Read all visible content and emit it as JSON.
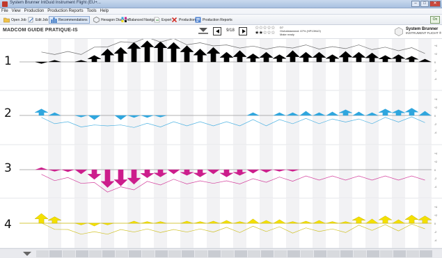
{
  "window": {
    "title": "System Brunner IntGuid Instrument Flight (EU+...",
    "buttons": [
      "–",
      "□",
      "✕"
    ]
  },
  "menu": {
    "items": [
      "File",
      "View",
      "Production",
      "Production Reports",
      "Tools",
      "Help"
    ]
  },
  "toolbar": {
    "items": [
      {
        "label": "Open Job",
        "icon": "folder-icon"
      },
      {
        "label": "Edit Job",
        "icon": "edit-icon"
      },
      {
        "label": "Recommendations",
        "icon": "bar-chart-icon",
        "active": true
      },
      {
        "label": "Hexagon Diagram",
        "icon": "hexagon-icon"
      },
      {
        "label": "Balanced Navigator",
        "icon": "navigator-icon"
      },
      {
        "label": "Export",
        "icon": "export-icon"
      },
      {
        "label": "Production",
        "icon": "close-red-icon"
      },
      {
        "label": "Production Reports",
        "icon": "report-icon"
      }
    ],
    "help_label": "On"
  },
  "header": {
    "guide_title": "MADCOM GUIDE PRATIQUE-IS",
    "page_indicator": "9/18",
    "stars_top": "☆☆☆☆☆",
    "stars_bottom_filled": "★★",
    "stars_bottom_empty": "☆☆☆",
    "meta_line1": "D7",
    "meta_line2": "Globalstandard: 67% (HP1394/2)",
    "meta_line3": "Make ready",
    "brand_name": "System Brunner",
    "brand_sub": "INSTRUMENT FLIGHT ®"
  },
  "rows": [
    {
      "label": "1",
      "color": "#000000",
      "bars": [
        -0.1,
        0.2,
        0,
        0.2,
        0.8,
        1.6,
        1.8,
        2.4,
        2.6,
        2.5,
        2.4,
        2.0,
        1.6,
        1.8,
        1.2,
        1.4,
        1.0,
        1.2,
        0.9,
        1.4,
        1.2,
        1.2,
        0.9,
        1.3,
        1.2,
        1.1,
        0.8,
        0.9,
        0.7,
        0.4
      ]
    },
    {
      "label": "2",
      "color": "#2fa6de",
      "bars": [
        0.8,
        0.4,
        0,
        -0.2,
        -0.6,
        0,
        -0.6,
        -0.3,
        -0.3,
        -0.2,
        0,
        0,
        0,
        0,
        0,
        0,
        0.4,
        0,
        0.4,
        0.4,
        0.6,
        0.4,
        0.5,
        0.7,
        0.5,
        0.4,
        0.8,
        0.7,
        0.9,
        0.6
      ]
    },
    {
      "label": "3",
      "color": "#cc1e8c",
      "bars": [
        0.3,
        -0.1,
        -0.3,
        -0.6,
        -1.2,
        -2.2,
        -2.0,
        -1.8,
        -1.0,
        -0.9,
        -0.6,
        -0.7,
        -0.9,
        -0.6,
        -0.9,
        -0.7,
        -0.5,
        -0.4,
        -0.2,
        -0.2,
        0,
        0,
        0,
        0,
        0,
        0,
        0,
        0,
        0,
        0
      ]
    },
    {
      "label": "4",
      "color": "#f4e000",
      "bars": [
        1.2,
        0.8,
        0,
        -0.1,
        -0.4,
        -0.1,
        0,
        0.3,
        0.1,
        0.2,
        0,
        0.3,
        0.1,
        0.3,
        0.4,
        0.2,
        0.6,
        0.4,
        0.5,
        0.1,
        0.3,
        0.4,
        0.1,
        0.2,
        0.8,
        0.6,
        0.9,
        0.5,
        1.0,
        0.9
      ]
    }
  ]
}
